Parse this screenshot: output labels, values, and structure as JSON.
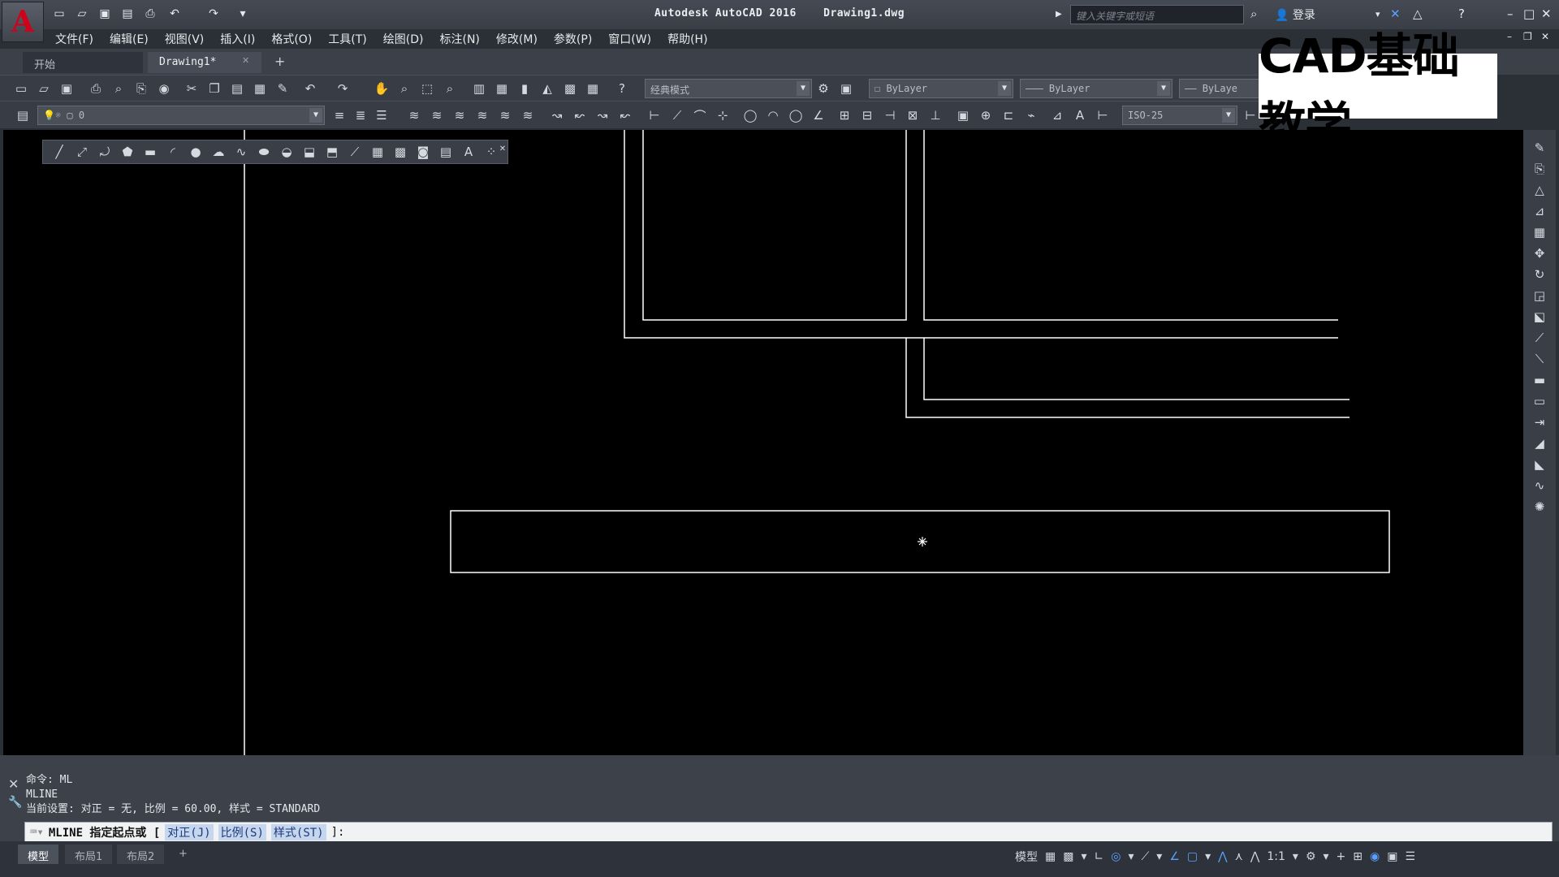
{
  "app": {
    "title": "Autodesk AutoCAD 2016",
    "file": "Drawing1.dwg",
    "search_placeholder": "键入关键字或短语",
    "login": "登录",
    "logo": "A"
  },
  "menus": [
    "文件(F)",
    "编辑(E)",
    "视图(V)",
    "插入(I)",
    "格式(O)",
    "工具(T)",
    "绘图(D)",
    "标注(N)",
    "修改(M)",
    "参数(P)",
    "窗口(W)",
    "帮助(H)"
  ],
  "tabs": {
    "start": "开始",
    "drawing": "Drawing1*",
    "add": "+"
  },
  "toolbar": {
    "workspace": "经典模式",
    "color": "ByLayer",
    "linetype": "ByLayer",
    "lineweight": "ByLaye",
    "layer": "0",
    "dimstyle": "ISO-25"
  },
  "watermark": "CAD基础教学",
  "command": {
    "history": [
      "命令: ML",
      "MLINE",
      "当前设置: 对正 = 无, 比例 = 60.00, 样式 = STANDARD"
    ],
    "prompt": "MLINE 指定起点或 [",
    "options": [
      "对正(J)",
      "比例(S)",
      "样式(ST)"
    ],
    "suffix": "]:"
  },
  "layout_tabs": [
    "模型",
    "布局1",
    "布局2",
    "+"
  ],
  "status": {
    "model": "模型",
    "scale": "1:1"
  },
  "colors": {
    "canvas": "#000000",
    "lines": "#ffffff",
    "accent": "#d0021b"
  }
}
